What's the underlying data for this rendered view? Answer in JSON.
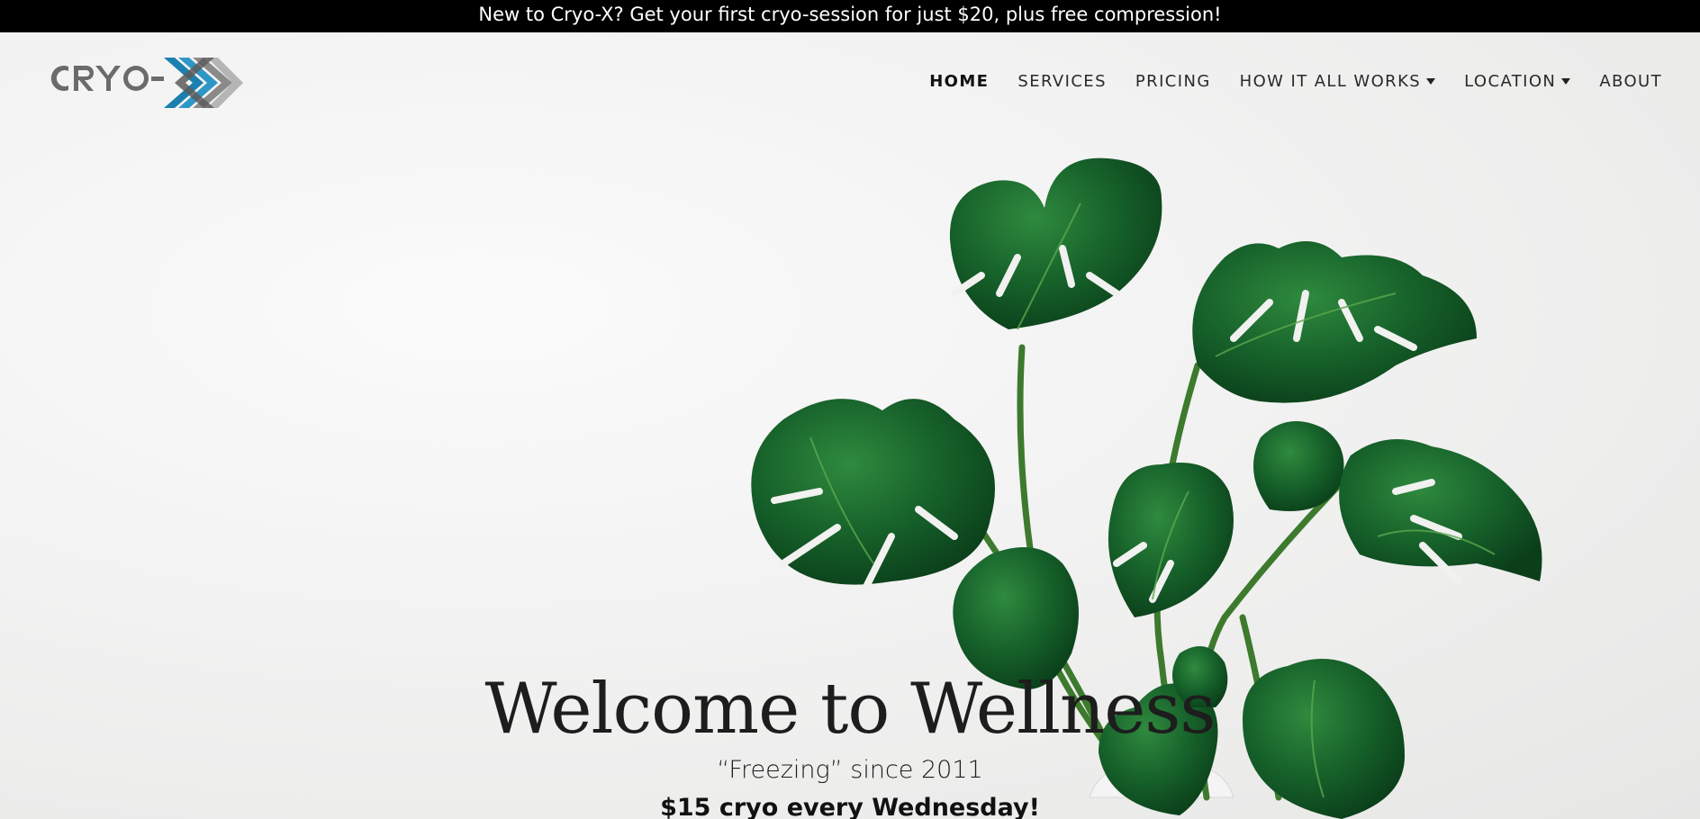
{
  "announcement": {
    "text": "New to Cryo-X? Get your first cryo-session for just $20, plus free compression!"
  },
  "brand": {
    "logo_text": "CRYO-X",
    "accent": "#1b7fb0",
    "gray": "#6b6b6b"
  },
  "nav": {
    "items": [
      {
        "label": "HOME",
        "active": true
      },
      {
        "label": "SERVICES"
      },
      {
        "label": "PRICING"
      },
      {
        "label": "HOW IT ALL WORKS",
        "dropdown": true
      },
      {
        "label": "LOCATION",
        "dropdown": true
      },
      {
        "label": "ABOUT"
      }
    ]
  },
  "hero": {
    "headline": "Welcome to Wellness",
    "subheadline": "“Freezing” since 2011",
    "promo": "$15 cryo every Wednesday!"
  }
}
